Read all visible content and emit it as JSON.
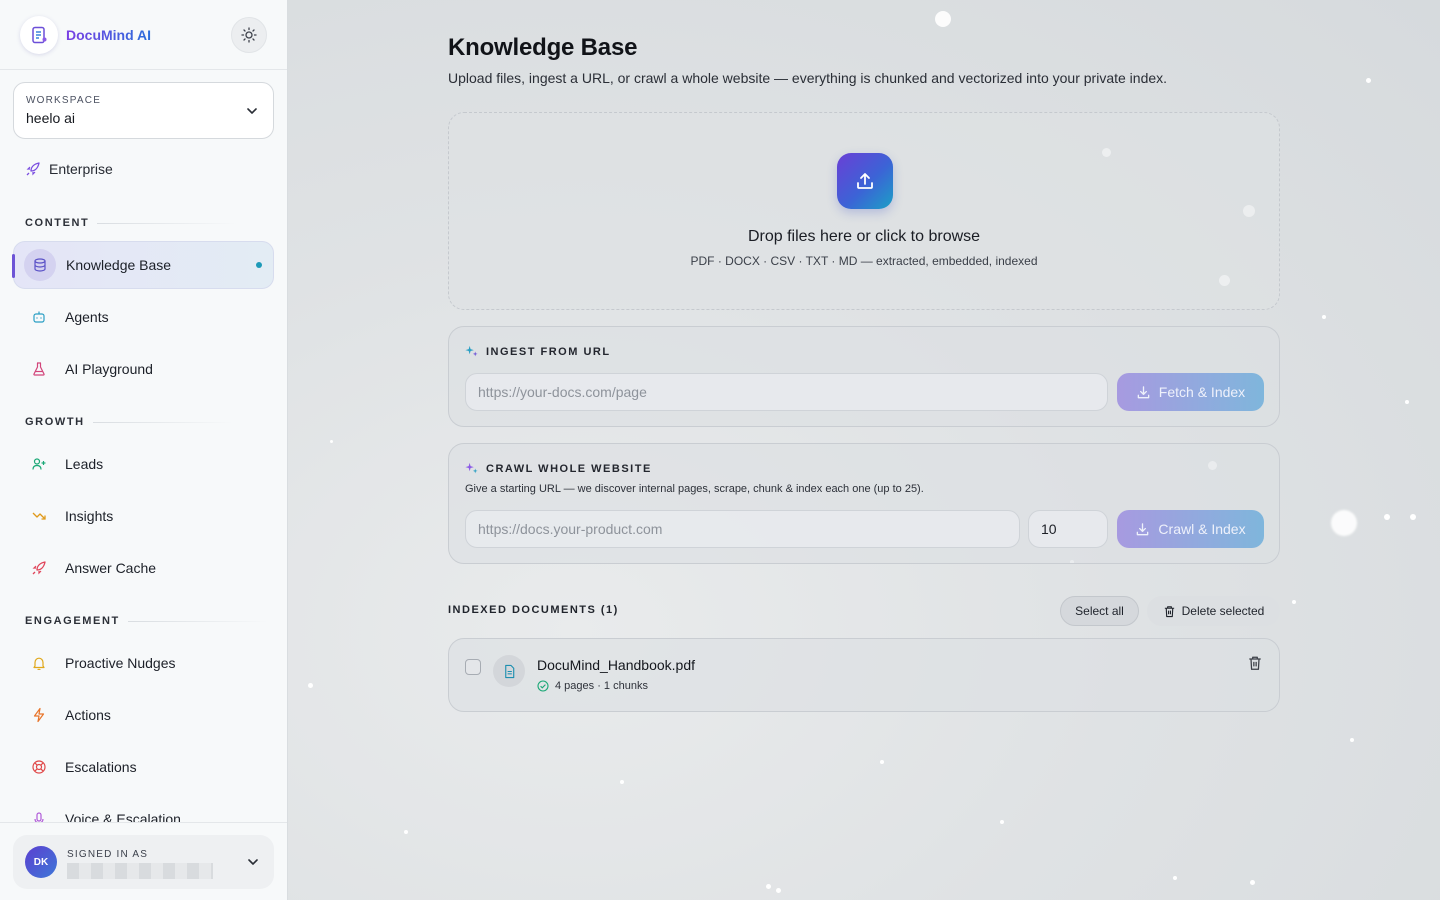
{
  "brand": {
    "name": "DocuMind AI"
  },
  "workspace": {
    "label": "WORKSPACE",
    "value": "heelo ai"
  },
  "plan": {
    "label": "Enterprise"
  },
  "sections": {
    "content": "CONTENT",
    "growth": "GROWTH",
    "engagement": "ENGAGEMENT"
  },
  "nav": {
    "knowledge_base": "Knowledge Base",
    "agents": "Agents",
    "ai_playground": "AI Playground",
    "leads": "Leads",
    "insights": "Insights",
    "answer_cache": "Answer Cache",
    "proactive_nudges": "Proactive Nudges",
    "actions": "Actions",
    "escalations": "Escalations",
    "voice_escalation": "Voice & Escalation"
  },
  "user": {
    "label": "SIGNED IN AS",
    "initials": "DK",
    "email": ""
  },
  "page": {
    "title": "Knowledge Base",
    "subtitle": "Upload files, ingest a URL, or crawl a whole website — everything is chunked and vectorized into your private index."
  },
  "dropzone": {
    "title": "Drop files here or click to browse",
    "subtitle": "PDF · DOCX · CSV · TXT · MD — extracted, embedded, indexed"
  },
  "ingest_url": {
    "heading": "INGEST FROM URL",
    "placeholder": "https://your-docs.com/page",
    "button": "Fetch & Index"
  },
  "crawl": {
    "heading": "CRAWL WHOLE WEBSITE",
    "description": "Give a starting URL — we discover internal pages, scrape, chunk & index each one (up to 25).",
    "placeholder": "https://docs.your-product.com",
    "max_pages": "10",
    "button": "Crawl & Index"
  },
  "documents": {
    "heading": "INDEXED DOCUMENTS (1)",
    "select_all": "Select all",
    "delete_selected": "Delete selected",
    "items": [
      {
        "name": "DocuMind_Handbook.pdf",
        "meta": "4 pages · 1 chunks"
      }
    ]
  },
  "colors": {
    "accent_purple": "#6d54d6",
    "accent_teal": "#1d9ab8",
    "button_gradient_start": "#a79ae0",
    "button_gradient_end": "#7fb6dc"
  },
  "icons": {
    "brand": "document-sparkle-icon",
    "theme": "sun-icon",
    "plan": "rocket-icon",
    "knowledge_base": "database-icon",
    "agents": "bot-icon",
    "ai_playground": "flask-icon",
    "leads": "user-plus-icon",
    "insights": "trending-down-icon",
    "answer_cache": "rocket-icon",
    "proactive_nudges": "bell-icon",
    "actions": "bolt-icon",
    "escalations": "lifebuoy-icon",
    "voice_escalation": "microphone-icon"
  }
}
